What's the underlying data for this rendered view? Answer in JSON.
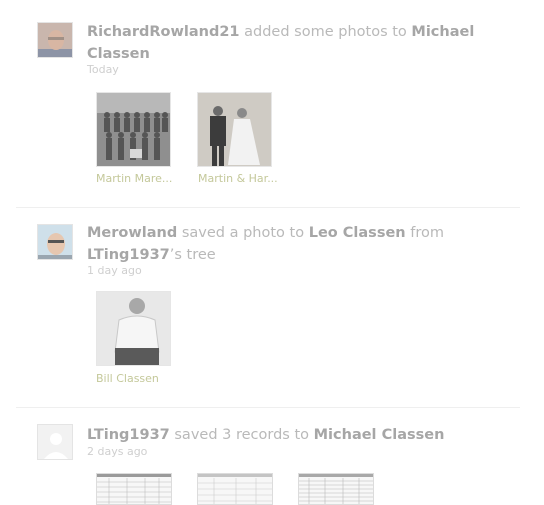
{
  "feed": [
    {
      "user": "RichardRowland21",
      "action": "added some photos to",
      "target": "Michael Classen",
      "time": "Today",
      "photos": [
        {
          "caption": "Martin Mare..."
        },
        {
          "caption": "Martin & Har..."
        }
      ]
    },
    {
      "user": "Merowland",
      "action": "saved a photo to",
      "target": "Leo Classen",
      "from_word": "from",
      "source": "LTing1937",
      "suffix": "’s tree",
      "time": "1 day ago",
      "photos": [
        {
          "caption": "Bill Classen"
        }
      ]
    },
    {
      "user": "LTing1937",
      "action": "saved 3 records to",
      "target": "Michael Classen",
      "time": "2 days ago",
      "records": 3
    }
  ]
}
